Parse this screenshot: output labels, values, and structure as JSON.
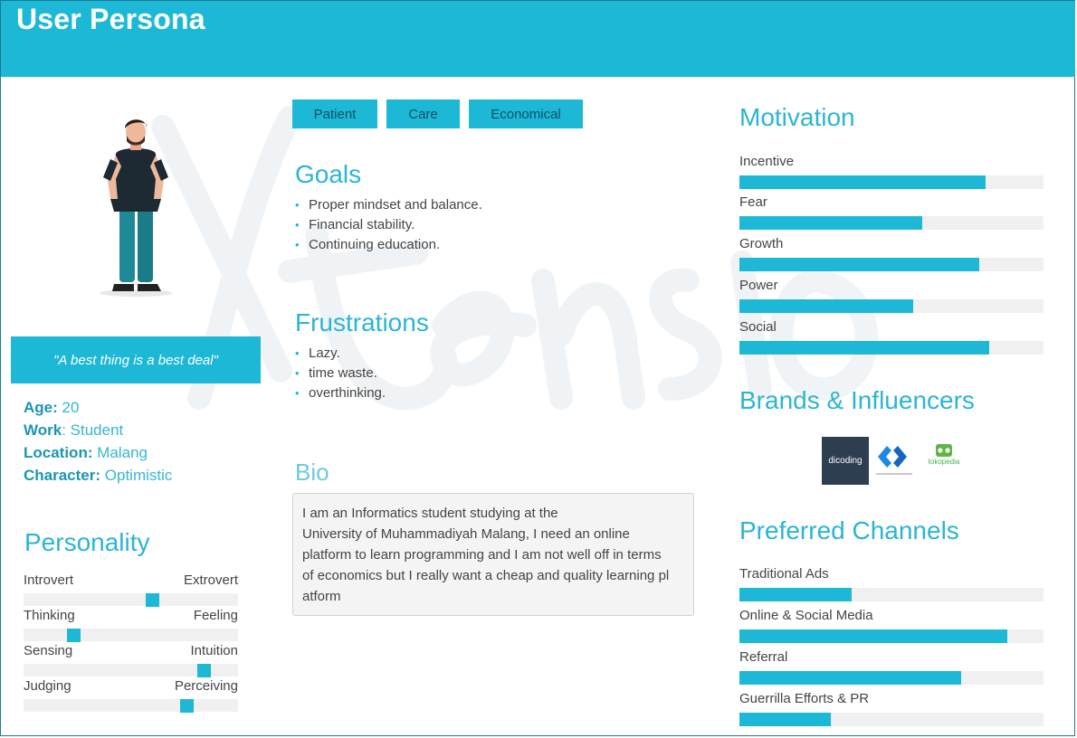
{
  "header": {
    "title": "User Persona"
  },
  "watermark": {
    "text": "Xtensio"
  },
  "profile": {
    "quote": "\"A best thing is a best deal\"",
    "age_label": "Age:",
    "age": "20",
    "work_label": "Work",
    "work": "Student",
    "location_label": "Location:",
    "location": "Malang",
    "character_label": "Character:",
    "character": "Optimistic"
  },
  "personality": {
    "title": "Personality",
    "traits": [
      {
        "left": "Introvert",
        "right": "Extrovert",
        "value": 0.6
      },
      {
        "left": "Thinking",
        "right": "Feeling",
        "value": 0.23
      },
      {
        "left": "Sensing",
        "right": "Intuition",
        "value": 0.84
      },
      {
        "left": "Judging",
        "right": "Perceiving",
        "value": 0.76
      }
    ]
  },
  "tags": [
    "Patient",
    "Care",
    "Economical"
  ],
  "goals": {
    "title": "Goals",
    "items": [
      "Proper mindset and balance.",
      "Financial stability.",
      "Continuing education."
    ]
  },
  "frustrations": {
    "title": "Frustrations",
    "items": [
      "Lazy.",
      "time waste.",
      "overthinking."
    ]
  },
  "bio": {
    "title": "Bio",
    "lines": [
      "I am an Informatics student studying at the",
      "University of Muhammadiyah Malang, I need an online",
      "platform to learn programming and I am not well off in terms",
      "of economics but I really want a cheap and quality learning pl",
      "atform"
    ]
  },
  "motivation": {
    "title": "Motivation",
    "items": [
      {
        "label": "Incentive",
        "value": 0.81
      },
      {
        "label": "Fear",
        "value": 0.6
      },
      {
        "label": "Growth",
        "value": 0.79
      },
      {
        "label": "Power",
        "value": 0.57
      },
      {
        "label": "Social",
        "value": 0.82
      }
    ]
  },
  "brands": {
    "title": "Brands & Influencers",
    "logos": [
      "dicoding",
      "tokopedia"
    ]
  },
  "channels": {
    "title": "Preferred Channels",
    "items": [
      {
        "label": "Traditional Ads",
        "value": 0.37
      },
      {
        "label": "Online & Social Media",
        "value": 0.88
      },
      {
        "label": "Referral",
        "value": 0.73
      },
      {
        "label": "Guerrilla Efforts & PR",
        "value": 0.3
      }
    ]
  },
  "colors": {
    "accent": "#1cb8d6",
    "text": "#444444",
    "track": "#f0f0f0"
  }
}
